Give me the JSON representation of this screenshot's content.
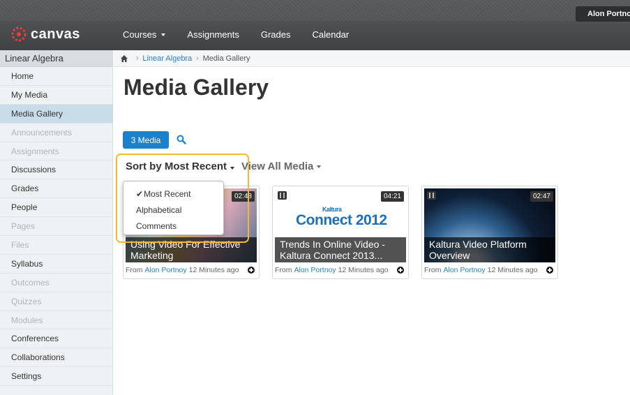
{
  "header": {
    "logo_text": "canvas",
    "user_name": "Alon Portnoy",
    "nav": [
      {
        "label": "Courses",
        "dropdown": true
      },
      {
        "label": "Assignments"
      },
      {
        "label": "Grades"
      },
      {
        "label": "Calendar"
      }
    ],
    "brand_color": "#e83e3e"
  },
  "sidebar": {
    "course_title": "Linear Algebra",
    "items": [
      {
        "label": "Home",
        "state": "enabled"
      },
      {
        "label": "My Media",
        "state": "enabled"
      },
      {
        "label": "Media Gallery",
        "state": "active"
      },
      {
        "label": "Announcements",
        "state": "disabled"
      },
      {
        "label": "Assignments",
        "state": "disabled"
      },
      {
        "label": "Discussions",
        "state": "enabled"
      },
      {
        "label": "Grades",
        "state": "enabled"
      },
      {
        "label": "People",
        "state": "enabled"
      },
      {
        "label": "Pages",
        "state": "disabled"
      },
      {
        "label": "Files",
        "state": "disabled"
      },
      {
        "label": "Syllabus",
        "state": "enabled"
      },
      {
        "label": "Outcomes",
        "state": "disabled"
      },
      {
        "label": "Quizzes",
        "state": "disabled"
      },
      {
        "label": "Modules",
        "state": "disabled"
      },
      {
        "label": "Conferences",
        "state": "enabled"
      },
      {
        "label": "Collaborations",
        "state": "enabled"
      },
      {
        "label": "Settings",
        "state": "enabled"
      }
    ]
  },
  "breadcrumb": {
    "course": "Linear Algebra",
    "current": "Media Gallery"
  },
  "main": {
    "title": "Media Gallery",
    "media_count_label": "3 Media",
    "sort_label": "Sort by Most Recent",
    "view_all_label": "View All Media",
    "sort_options": [
      {
        "label": "Most Recent",
        "checked": true
      },
      {
        "label": "Alphabetical",
        "checked": false
      },
      {
        "label": "Comments",
        "checked": false
      }
    ],
    "media": [
      {
        "title": "Using Video For Effective Marketing",
        "duration": "02:48",
        "from": "From",
        "author": "Alon Portnoy",
        "time": "12 Minutes ago"
      },
      {
        "title": "Trends In Online Video - Kaltura Connect 2013...",
        "duration": "04:21",
        "from": "From",
        "author": "Alon Portnoy",
        "time": "12 Minutes ago",
        "thumb_text": "Connect 2012",
        "thumb_sub": "Kaltura"
      },
      {
        "title": "Kaltura Video Platform Overview",
        "duration": "02:47",
        "from": "From",
        "author": "Alon Portnoy",
        "time": "12 Minutes ago"
      }
    ],
    "highlight_color": "#f3b73b",
    "accent_color": "#1a82cc"
  }
}
